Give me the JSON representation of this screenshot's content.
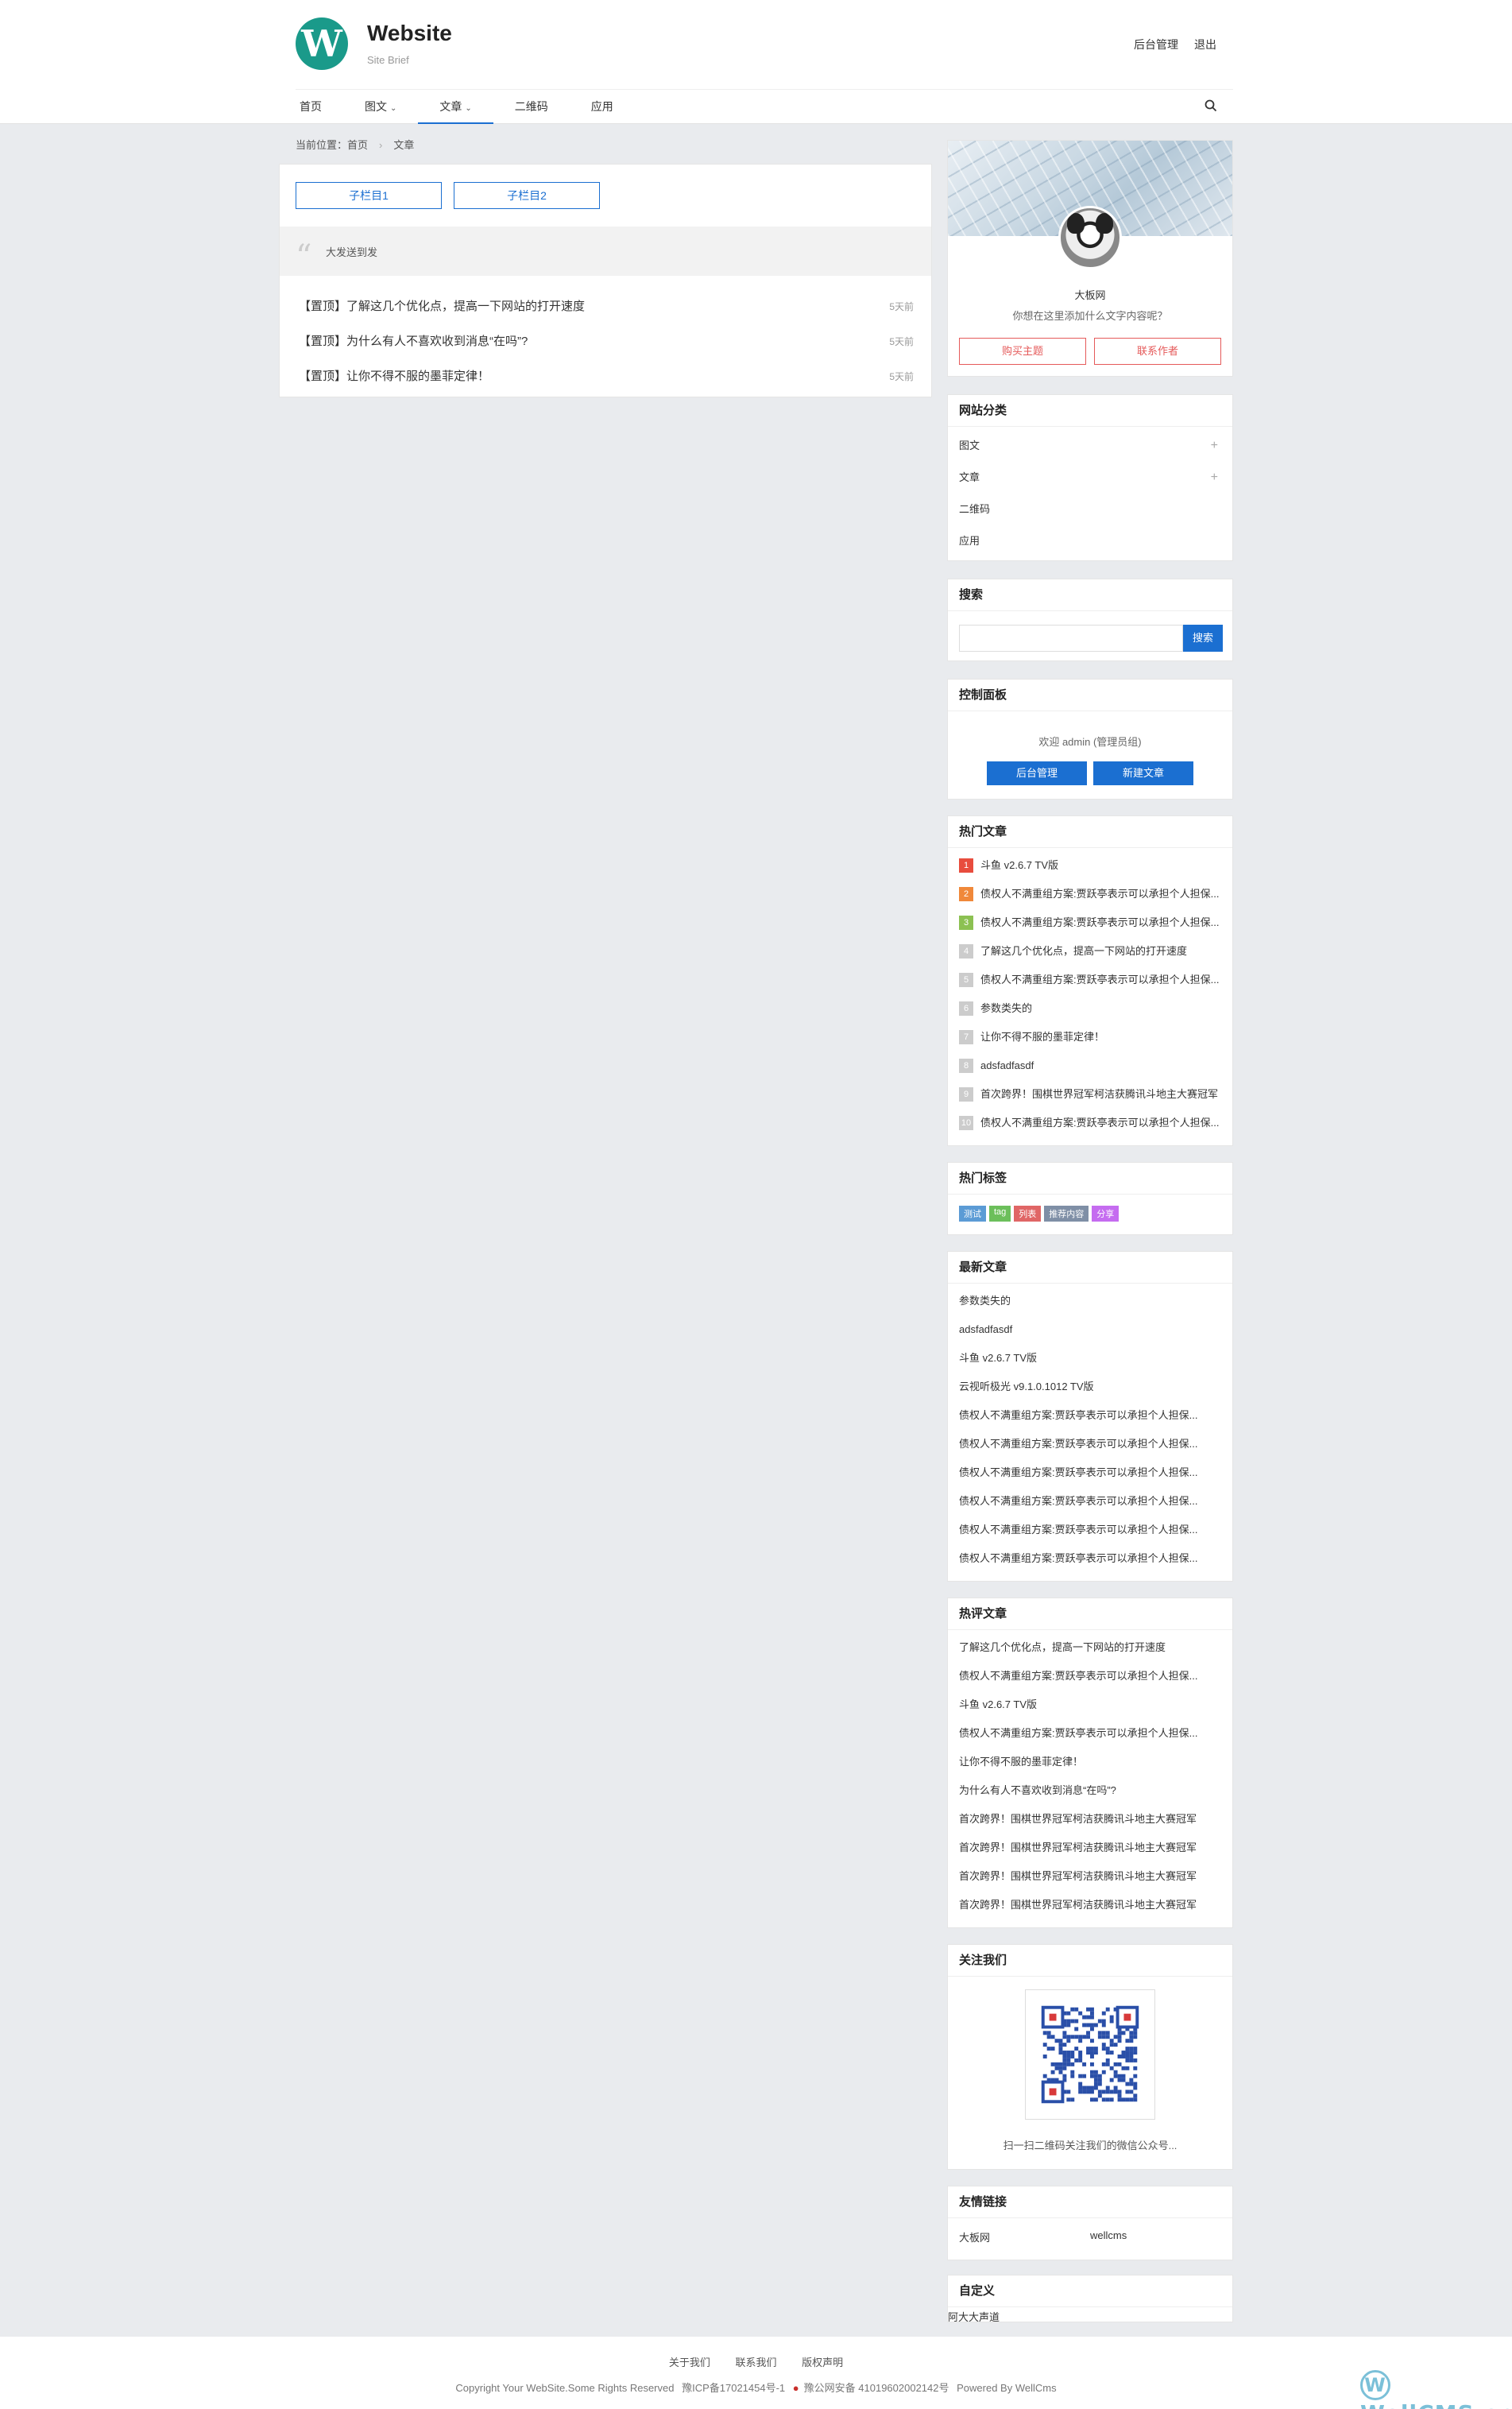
{
  "header": {
    "logo_letter": "W",
    "site_title": "Website",
    "site_brief": "Site Brief",
    "admin_link": "后台管理",
    "logout_link": "退出"
  },
  "nav": {
    "items": [
      {
        "label": "首页",
        "dropdown": false
      },
      {
        "label": "图文",
        "dropdown": true
      },
      {
        "label": "文章",
        "dropdown": true,
        "active": true
      },
      {
        "label": "二维码",
        "dropdown": false
      },
      {
        "label": "应用",
        "dropdown": false
      }
    ]
  },
  "breadcrumb": {
    "prefix": "当前位置：",
    "home": "首页",
    "sep": "›",
    "current": "文章"
  },
  "main": {
    "sub_buttons": [
      "子栏目1",
      "子栏目2"
    ],
    "notice": "大发送到发",
    "posts": [
      {
        "title": "【置顶】了解这几个优化点，提高一下网站的打开速度",
        "time": "5天前"
      },
      {
        "title": "【置顶】为什么有人不喜欢收到消息“在吗”?",
        "time": "5天前"
      },
      {
        "title": "【置顶】让你不得不服的墨菲定律！",
        "time": "5天前"
      }
    ]
  },
  "profile": {
    "name": "大板网",
    "desc": "你想在这里添加什么文字内容呢？",
    "buy_label": "购买主题",
    "contact_label": "联系作者"
  },
  "categories": {
    "title": "网站分类",
    "items": [
      {
        "label": "图文",
        "expand": "+"
      },
      {
        "label": "文章",
        "expand": "+"
      },
      {
        "label": "二维码",
        "expand": ""
      },
      {
        "label": "应用",
        "expand": ""
      }
    ]
  },
  "search": {
    "title": "搜索",
    "button": "搜索",
    "placeholder": ""
  },
  "control": {
    "title": "控制面板",
    "welcome": "欢迎 admin (管理员组)",
    "admin_btn": "后台管理",
    "new_post_btn": "新建文章"
  },
  "hot_posts": {
    "title": "热门文章",
    "items": [
      {
        "rank": "1",
        "color": "#e84c3d",
        "title": "斗鱼 v2.6.7 TV版"
      },
      {
        "rank": "2",
        "color": "#f0883a",
        "title": "债权人不满重组方案:贾跃亭表示可以承担个人担保..."
      },
      {
        "rank": "3",
        "color": "#8cc152",
        "title": "债权人不满重组方案:贾跃亭表示可以承担个人担保..."
      },
      {
        "rank": "4",
        "color": "#cccccc",
        "title": "了解这几个优化点，提高一下网站的打开速度"
      },
      {
        "rank": "5",
        "color": "#cccccc",
        "title": "债权人不满重组方案:贾跃亭表示可以承担个人担保..."
      },
      {
        "rank": "6",
        "color": "#cccccc",
        "title": "参数类失的"
      },
      {
        "rank": "7",
        "color": "#cccccc",
        "title": "让你不得不服的墨菲定律！"
      },
      {
        "rank": "8",
        "color": "#cccccc",
        "title": "adsfadfasdf"
      },
      {
        "rank": "9",
        "color": "#cccccc",
        "title": "首次跨界！围棋世界冠军柯洁获腾讯斗地主大赛冠军"
      },
      {
        "rank": "10",
        "color": "#cccccc",
        "title": "债权人不满重组方案:贾跃亭表示可以承担个人担保..."
      }
    ]
  },
  "hot_tags": {
    "title": "热门标签",
    "items": [
      {
        "label": "测试",
        "color": "#5b9bd5"
      },
      {
        "label": "tag",
        "color": "#6cbf5b"
      },
      {
        "label": "列表",
        "color": "#e06666"
      },
      {
        "label": "推荐内容",
        "color": "#7f8fa6"
      },
      {
        "label": "分享",
        "color": "#c56cf0"
      }
    ]
  },
  "latest_posts": {
    "title": "最新文章",
    "items": [
      "参数类失的",
      "adsfadfasdf",
      "斗鱼 v2.6.7 TV版",
      "云视听极光 v9.1.0.1012 TV版",
      "债权人不满重组方案:贾跃亭表示可以承担个人担保...",
      "债权人不满重组方案:贾跃亭表示可以承担个人担保...",
      "债权人不满重组方案:贾跃亭表示可以承担个人担保...",
      "债权人不满重组方案:贾跃亭表示可以承担个人担保...",
      "债权人不满重组方案:贾跃亭表示可以承担个人担保...",
      "债权人不满重组方案:贾跃亭表示可以承担个人担保..."
    ]
  },
  "hot_comments": {
    "title": "热评文章",
    "items": [
      "了解这几个优化点，提高一下网站的打开速度",
      "债权人不满重组方案:贾跃亭表示可以承担个人担保...",
      "斗鱼 v2.6.7 TV版",
      "债权人不满重组方案:贾跃亭表示可以承担个人担保...",
      "让你不得不服的墨菲定律！",
      "为什么有人不喜欢收到消息“在吗”?",
      "首次跨界！围棋世界冠军柯洁获腾讯斗地主大赛冠军",
      "首次跨界！围棋世界冠军柯洁获腾讯斗地主大赛冠军",
      "首次跨界！围棋世界冠军柯洁获腾讯斗地主大赛冠军",
      "首次跨界！围棋世界冠军柯洁获腾讯斗地主大赛冠军"
    ]
  },
  "follow": {
    "title": "关注我们",
    "caption": "扫一扫二维码关注我们的微信公众号..."
  },
  "links": {
    "title": "友情链接",
    "items": [
      "大板网",
      "wellcms"
    ]
  },
  "custom": {
    "title": "自定义",
    "text": "阿大大声道"
  },
  "footer": {
    "links": [
      "关于我们",
      "联系我们",
      "版权声明"
    ],
    "copyright": "Copyright Your WebSite.Some Rights Reserved",
    "icp": "豫ICP备17021454号-1",
    "police": "豫公网安备 41019602002142号",
    "powered": "Powered By WellCms",
    "brand": "WellCMS.cn"
  }
}
